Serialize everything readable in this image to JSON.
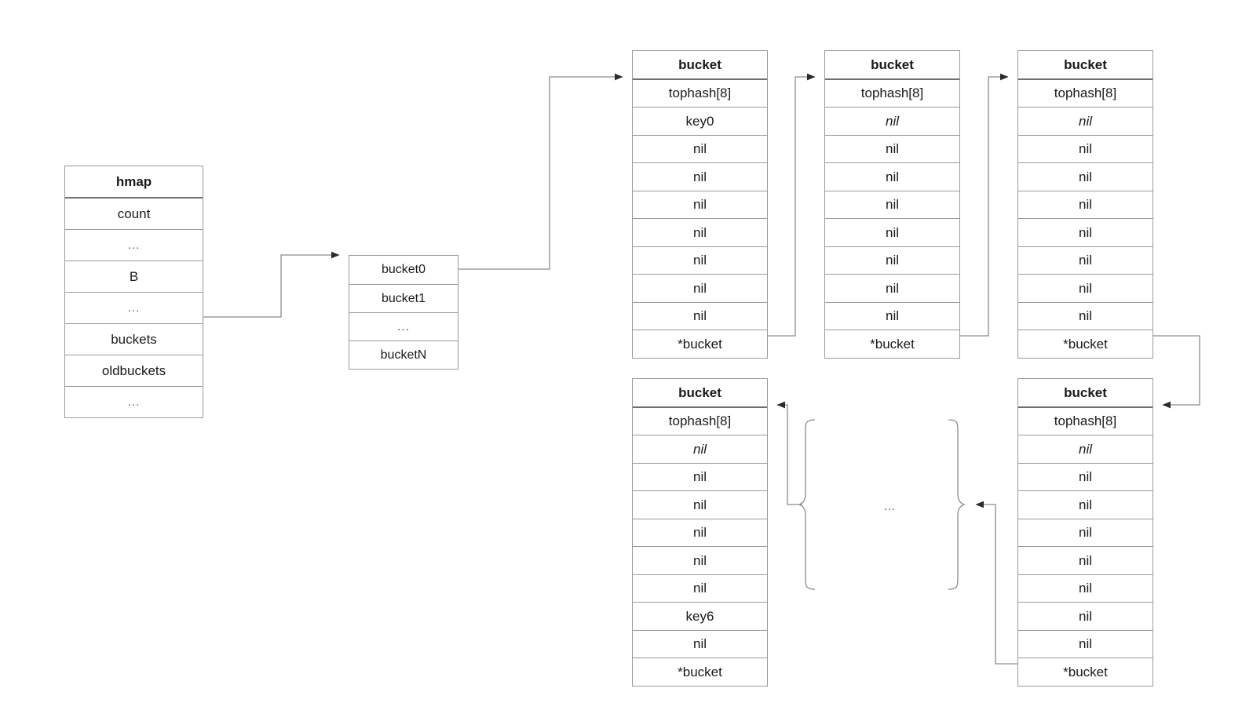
{
  "diagram": {
    "title": "Go map hmap bucket chain diagram",
    "line_color": "#8c8c8c",
    "border_color": "#9a9a9a",
    "text_color": "#1a1a1a",
    "ellipsis": "...",
    "middle_ellipsis": "..."
  },
  "hmap": {
    "header": "hmap",
    "rows": [
      {
        "label": "count",
        "style": "normal"
      },
      {
        "label": "...",
        "style": "dots"
      },
      {
        "label": "B",
        "style": "normal"
      },
      {
        "label": "...",
        "style": "dots"
      },
      {
        "label": "buckets",
        "style": "normal"
      },
      {
        "label": "oldbuckets",
        "style": "normal"
      },
      {
        "label": "...",
        "style": "dots"
      }
    ]
  },
  "bucket_array": {
    "rows": [
      {
        "label": "bucket0",
        "style": "normal"
      },
      {
        "label": "bucket1",
        "style": "normal"
      },
      {
        "label": "...",
        "style": "dots"
      },
      {
        "label": "bucketN",
        "style": "normal"
      }
    ]
  },
  "buckets": [
    {
      "id": "b0",
      "header": "bucket",
      "rows": [
        {
          "label": "tophash[8]",
          "style": "normal"
        },
        {
          "label": "key0",
          "style": "normal"
        },
        {
          "label": "nil",
          "style": "normal"
        },
        {
          "label": "nil",
          "style": "normal"
        },
        {
          "label": "nil",
          "style": "normal"
        },
        {
          "label": "nil",
          "style": "normal"
        },
        {
          "label": "nil",
          "style": "normal"
        },
        {
          "label": "nil",
          "style": "normal"
        },
        {
          "label": "nil",
          "style": "normal"
        },
        {
          "label": "*bucket",
          "style": "normal"
        }
      ]
    },
    {
      "id": "b1",
      "header": "bucket",
      "rows": [
        {
          "label": "tophash[8]",
          "style": "normal"
        },
        {
          "label": "nil",
          "style": "italic"
        },
        {
          "label": "nil",
          "style": "normal"
        },
        {
          "label": "nil",
          "style": "normal"
        },
        {
          "label": "nil",
          "style": "normal"
        },
        {
          "label": "nil",
          "style": "normal"
        },
        {
          "label": "nil",
          "style": "normal"
        },
        {
          "label": "nil",
          "style": "normal"
        },
        {
          "label": "nil",
          "style": "normal"
        },
        {
          "label": "*bucket",
          "style": "normal"
        }
      ]
    },
    {
      "id": "b2",
      "header": "bucket",
      "rows": [
        {
          "label": "tophash[8]",
          "style": "normal"
        },
        {
          "label": "nil",
          "style": "italic"
        },
        {
          "label": "nil",
          "style": "normal"
        },
        {
          "label": "nil",
          "style": "normal"
        },
        {
          "label": "nil",
          "style": "normal"
        },
        {
          "label": "nil",
          "style": "normal"
        },
        {
          "label": "nil",
          "style": "normal"
        },
        {
          "label": "nil",
          "style": "normal"
        },
        {
          "label": "nil",
          "style": "normal"
        },
        {
          "label": "*bucket",
          "style": "normal"
        }
      ]
    },
    {
      "id": "b3",
      "header": "bucket",
      "rows": [
        {
          "label": "tophash[8]",
          "style": "normal"
        },
        {
          "label": "nil",
          "style": "italic"
        },
        {
          "label": "nil",
          "style": "normal"
        },
        {
          "label": "nil",
          "style": "normal"
        },
        {
          "label": "nil",
          "style": "normal"
        },
        {
          "label": "nil",
          "style": "normal"
        },
        {
          "label": "nil",
          "style": "normal"
        },
        {
          "label": "key6",
          "style": "normal"
        },
        {
          "label": "nil",
          "style": "normal"
        },
        {
          "label": "*bucket",
          "style": "normal"
        }
      ]
    },
    {
      "id": "b4",
      "header": "bucket",
      "rows": [
        {
          "label": "tophash[8]",
          "style": "normal"
        },
        {
          "label": "nil",
          "style": "italic"
        },
        {
          "label": "nil",
          "style": "normal"
        },
        {
          "label": "nil",
          "style": "normal"
        },
        {
          "label": "nil",
          "style": "normal"
        },
        {
          "label": "nil",
          "style": "normal"
        },
        {
          "label": "nil",
          "style": "normal"
        },
        {
          "label": "nil",
          "style": "normal"
        },
        {
          "label": "nil",
          "style": "normal"
        },
        {
          "label": "*bucket",
          "style": "normal"
        }
      ]
    }
  ],
  "connections": [
    {
      "name": "hmap-buckets-to-array",
      "from": "hmap.buckets",
      "to": "bucket_array"
    },
    {
      "name": "array-bucket0-to-b0",
      "from": "bucket_array.bucket0",
      "to": "b0"
    },
    {
      "name": "b0-overflow-to-b1",
      "from": "b0.*bucket",
      "to": "b1"
    },
    {
      "name": "b1-overflow-to-b2",
      "from": "b1.*bucket",
      "to": "b2"
    },
    {
      "name": "b2-overflow-to-b4",
      "from": "b2.*bucket",
      "to": "b4"
    },
    {
      "name": "b4-overflow-to-ellipsis",
      "from": "b4.*bucket",
      "to": "right-brace"
    },
    {
      "name": "ellipsis-to-b3",
      "from": "left-brace",
      "to": "b3"
    }
  ]
}
